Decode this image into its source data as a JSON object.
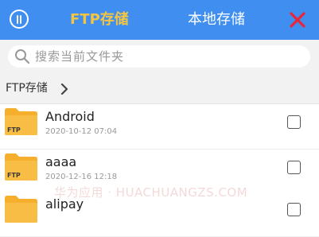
{
  "header": {
    "tab_ftp": "FTP存储",
    "tab_local": "本地存储",
    "accent_color": "#3f8ef0",
    "active_tab_color": "#f4c542",
    "close_color": "#e8263a"
  },
  "search": {
    "placeholder": "搜索当前文件夹"
  },
  "breadcrumb": {
    "label": "FTP存储"
  },
  "folder_badge": "FTP",
  "files": [
    {
      "name": "Android",
      "date": "2020-10-12 07:04"
    },
    {
      "name": "aaaa",
      "date": "2020-12-16 12:18"
    },
    {
      "name": "alipay",
      "date": ""
    }
  ],
  "watermark": "华为应用 · HUACHUANGZS.COM"
}
